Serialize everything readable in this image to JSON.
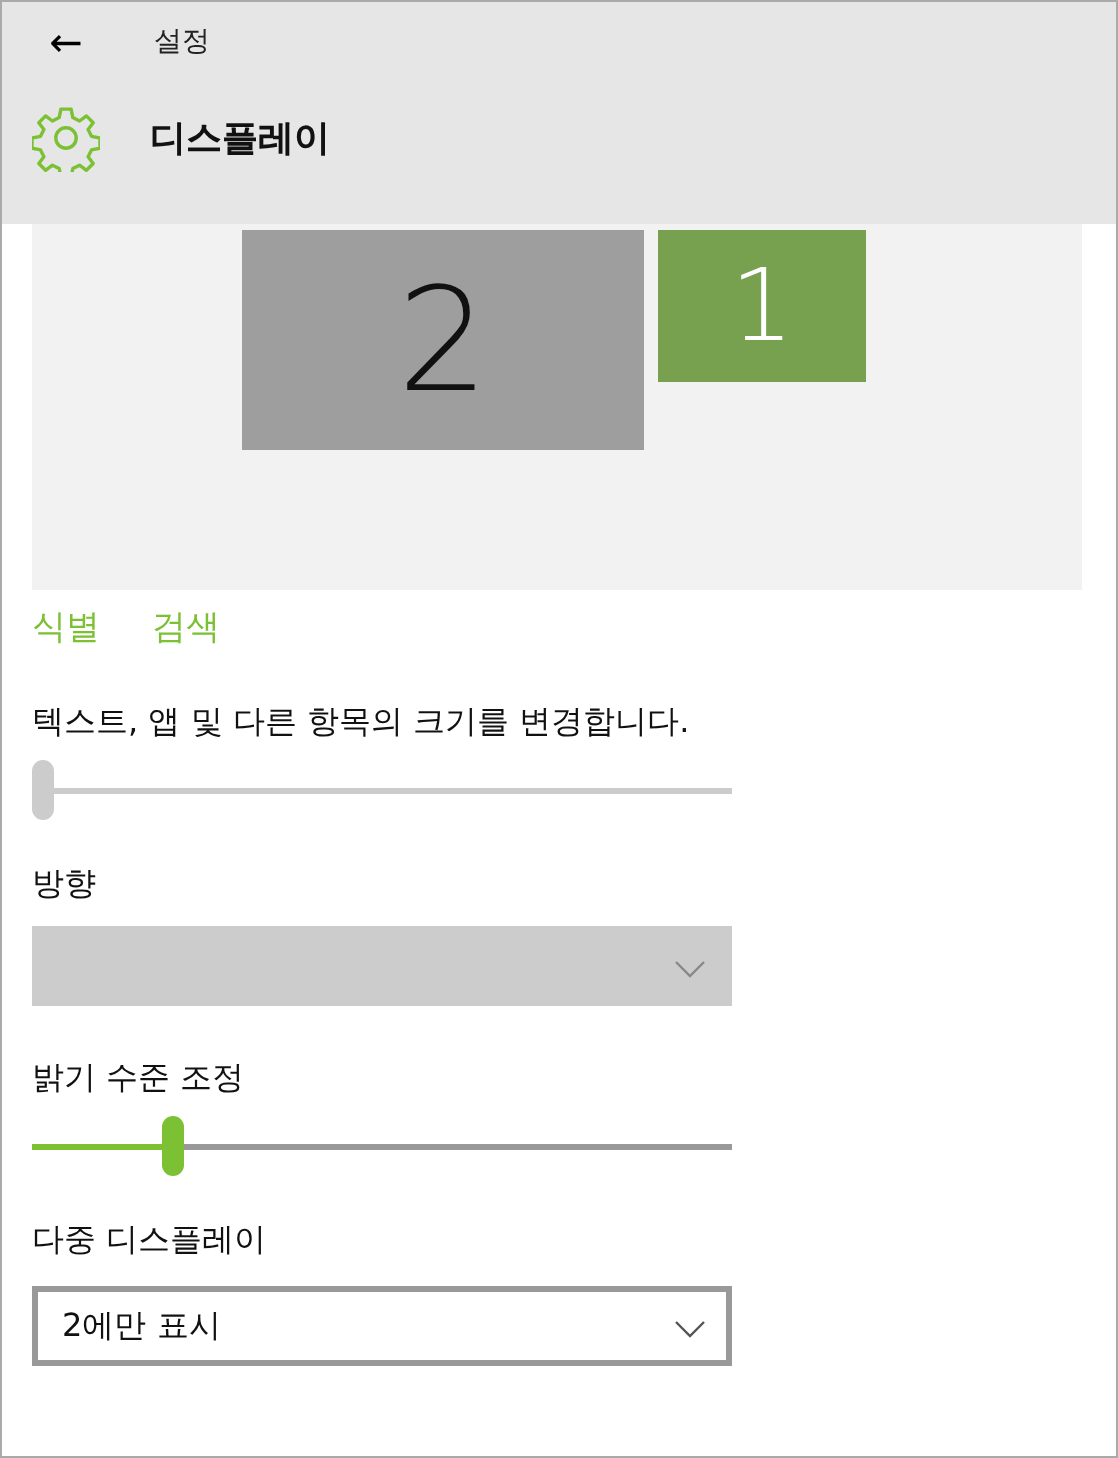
{
  "header": {
    "back": "←",
    "app": "설정",
    "title": "디스플레이"
  },
  "monitors": [
    {
      "label": "2",
      "selected": false
    },
    {
      "label": "1",
      "selected": true
    }
  ],
  "links": [
    "식별",
    "검색"
  ],
  "scale": {
    "label": "텍스트, 앱 및 다른 항목의 크기를 변경합니다.",
    "level": 0,
    "disabled": true
  },
  "orientation": {
    "label": "방향",
    "disabled": true
  },
  "brightness": {
    "label": "밝기 수준 조정",
    "level": 0.19,
    "disabled": false
  },
  "multiple": {
    "label": "다중 디스플레이",
    "value": "2에만 표시",
    "disabled": false
  }
}
